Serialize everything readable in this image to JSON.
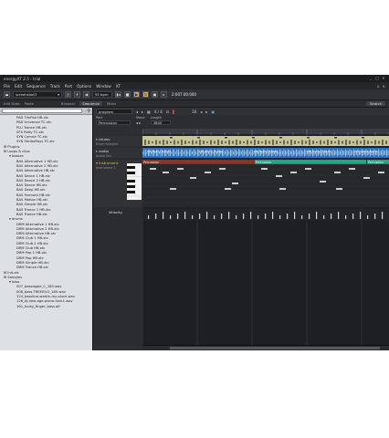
{
  "window": {
    "title": "energyXT 2.5 - trial"
  },
  "menu": [
    "File",
    "Edit",
    "Sequence",
    "Track",
    "Part",
    "Options",
    "Window",
    "XT"
  ],
  "toolbar": {
    "project": "screenshot3",
    "tempo": "95 bpm",
    "position": "2:007:00:000"
  },
  "subtoolbar": {
    "edit_data": "Edit Data",
    "paste": "Paste",
    "browser": "Browser",
    "sequence": "Sequence",
    "mixer": "Mixer",
    "search": "Search"
  },
  "browser": {
    "items": [
      {
        "label": "PAD TimPad HB.xtc",
        "level": 2
      },
      {
        "label": "PAD Universal TC.xtc",
        "level": 2
      },
      {
        "label": "PLU Trance HB.xtc",
        "level": 2
      },
      {
        "label": "SFX Potty TC.xtc",
        "level": 2
      },
      {
        "label": "SYN Cymrie TC.xtc",
        "level": 2
      },
      {
        "label": "SYN StellarRays TC.xtc",
        "level": 2
      },
      {
        "label": "Plugins",
        "level": 0
      },
      {
        "label": "Loops & clips",
        "level": 0
      },
      {
        "label": "basses",
        "level": 1
      },
      {
        "label": "BAS Alternative 1 HB.xtc",
        "level": 2
      },
      {
        "label": "BAS Alternative 2 HB.xtc",
        "level": 2
      },
      {
        "label": "BAS Alternative HB.xtc",
        "level": 2
      },
      {
        "label": "BAS Dance 1 HB.xtc",
        "level": 2
      },
      {
        "label": "BAS Dance 2 HB.xtc",
        "level": 2
      },
      {
        "label": "BAS Dance HB.xtc",
        "level": 2
      },
      {
        "label": "BAS Deep HB.xtc",
        "level": 2
      },
      {
        "label": "BAS Formant HB.xtc",
        "level": 2
      },
      {
        "label": "BAS Motion HB.xtc",
        "level": 2
      },
      {
        "label": "BAS Simple HB.xtc",
        "level": 2
      },
      {
        "label": "BAS Trance 1 HB.xtc",
        "level": 2
      },
      {
        "label": "BAS Trance HB.xtc",
        "level": 2
      },
      {
        "label": "drums",
        "level": 1
      },
      {
        "label": "DRM Alternative 1 HB.xtc",
        "level": 2
      },
      {
        "label": "DRM Alternative 2 HB.xtc",
        "level": 2
      },
      {
        "label": "DRM Alternative HB.xtc",
        "level": 2
      },
      {
        "label": "DRM Club 1 HB.xtc",
        "level": 2
      },
      {
        "label": "DRM Club 2 HB.xtc",
        "level": 2
      },
      {
        "label": "DRM Club HB.xtc",
        "level": 2
      },
      {
        "label": "DRM Pop 1 HB.xtc",
        "level": 2
      },
      {
        "label": "DRM Pop HB.xtc",
        "level": 2
      },
      {
        "label": "DRM Simple HB.xtc",
        "level": 2
      },
      {
        "label": "DRM Trance HB.xtc",
        "level": 2
      },
      {
        "label": "Init.xtc",
        "level": 0
      },
      {
        "label": "Samples",
        "level": 0
      },
      {
        "label": "bass",
        "level": 1
      },
      {
        "label": "007_bassapple_C_185.wav",
        "level": 2
      },
      {
        "label": "008_bass-TREMOLO_185.wav",
        "level": 2
      },
      {
        "label": "124_bassline-walkin-my-pluck.wav",
        "level": 2
      },
      {
        "label": "126_AJ-new-age-piano-funk1.wav",
        "level": 2
      },
      {
        "label": "161_funky_finger_bass.aif",
        "level": 2
      }
    ]
  },
  "panel": {
    "mode": "program",
    "signature": "4 / 4",
    "quantize": "16",
    "part_label": "Part",
    "part_value": "Percussion",
    "move_label": "Move",
    "length_label": "Length",
    "length_value": "3840"
  },
  "tracks": [
    {
      "name": "drums",
      "sub": "Drum Sampler"
    },
    {
      "name": "audio",
      "sub": "Audio Out"
    },
    {
      "name": "Instrument",
      "sub": "Instrument 1"
    }
  ],
  "velocity_label": "Velocity",
  "part_name": "Percussion",
  "audio_clip_label": "128_techno_fluente",
  "colors": {
    "drum_part": "#c9c59a",
    "audio_part": "#2f6fb2",
    "inst_part_a": "#8a3326",
    "inst_part_b": "#1fa884"
  }
}
